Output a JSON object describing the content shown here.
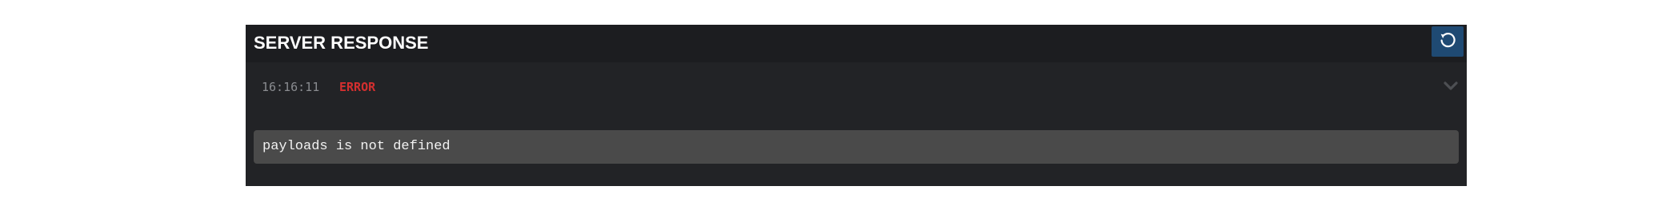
{
  "panel": {
    "title": "SERVER RESPONSE",
    "refresh_icon": "refresh-icon"
  },
  "log": {
    "time": "16:16:11",
    "level": "ERROR",
    "expand_icon": "chevron-down-icon",
    "message": "payloads is not defined"
  },
  "colors": {
    "panel_bg": "#222326",
    "header_bg": "#1c1d20",
    "accent_button": "#1f4a73",
    "error": "#d32f2f",
    "message_bg": "#4a4a4a"
  }
}
